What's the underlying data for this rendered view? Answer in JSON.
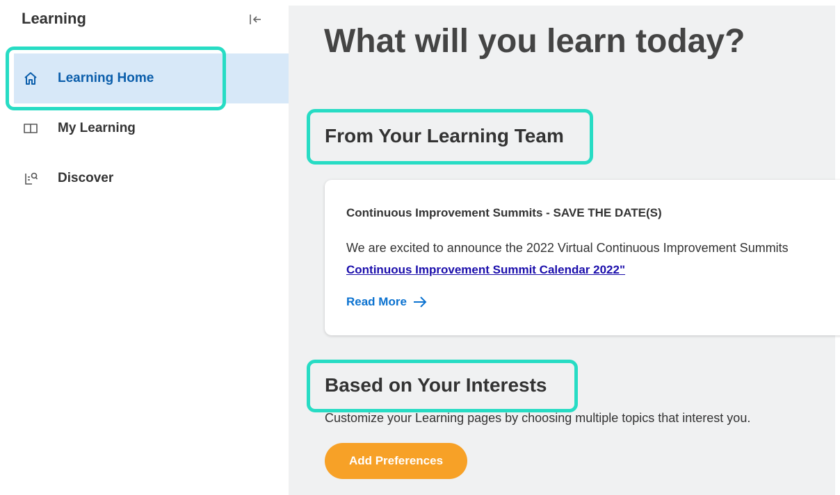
{
  "sidebar": {
    "title": "Learning",
    "items": [
      {
        "label": "Learning Home",
        "icon": "home-icon",
        "active": true
      },
      {
        "label": "My Learning",
        "icon": "book-icon",
        "active": false
      },
      {
        "label": "Discover",
        "icon": "discover-icon",
        "active": false
      }
    ]
  },
  "main": {
    "title": "What will you learn today?",
    "learning_team": {
      "heading": "From Your Learning Team",
      "card": {
        "title": "Continuous Improvement Summits - SAVE THE DATE(S)",
        "body": "We are excited to announce the 2022 Virtual Continuous Improvement Summits",
        "link": "Continuous Improvement Summit Calendar 2022\"",
        "read_more": "Read More"
      }
    },
    "interests": {
      "heading": "Based on Your Interests",
      "description": "Customize your Learning pages by choosing multiple topics that interest you.",
      "button": "Add Preferences"
    }
  },
  "colors": {
    "highlight": "#27dcc4",
    "active_bg": "#d7e8f8",
    "active_text": "#0b5eab",
    "link": "#1a0dab",
    "read_more": "#0b72d0",
    "button": "#f7a127"
  }
}
